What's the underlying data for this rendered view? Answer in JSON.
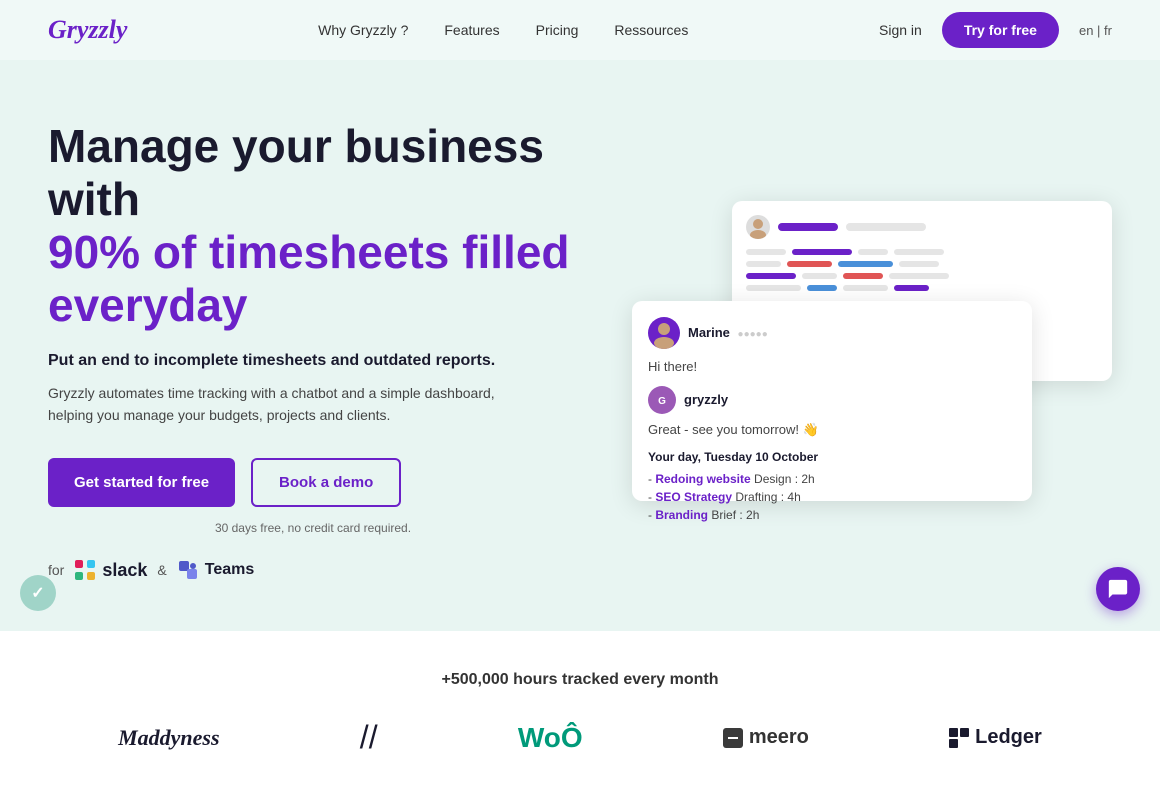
{
  "navbar": {
    "logo": "Gryzzly",
    "links": [
      {
        "label": "Why Gryzzly ?",
        "id": "why"
      },
      {
        "label": "Features",
        "id": "features"
      },
      {
        "label": "Pricing",
        "id": "pricing"
      },
      {
        "label": "Ressources",
        "id": "ressources"
      }
    ],
    "sign_in": "Sign in",
    "try_btn": "Try for free",
    "lang": "en | fr"
  },
  "hero": {
    "title_line1": "Manage your business with",
    "title_line2": "90% of timesheets filled",
    "title_line3": "everyday",
    "subtitle": "Put an end to incomplete timesheets and outdated reports.",
    "description": "Gryzzly automates time tracking with a chatbot and a simple dashboard, helping you manage your budgets, projects and clients.",
    "btn_primary": "Get started for free",
    "btn_secondary": "Book a demo",
    "note": "30 days free, no credit card required.",
    "for_label": "for",
    "and_label": "&",
    "slack_label": "slack",
    "teams_label": "Teams"
  },
  "mockup": {
    "user_name": "Marine",
    "user_greeting": "Hi there!",
    "bot_name": "gryzzly",
    "bot_message": "Great - see you tomorrow! 👋",
    "day_label": "Your day, Tuesday 10 October",
    "items": [
      {
        "prefix": "- ",
        "link": "Redoing website",
        "text": " Design : 2h"
      },
      {
        "prefix": "- ",
        "link": "SEO Strategy",
        "text": " Drafting : 4h"
      },
      {
        "prefix": "- ",
        "link": "Branding",
        "text": " Brief : 2h"
      }
    ]
  },
  "stats": {
    "tracked": "+500,000 hours tracked every month"
  },
  "logos": [
    {
      "label": "Maddyness",
      "style": "maddyness"
    },
    {
      "label": "//",
      "style": "slash"
    },
    {
      "label": "WoÔ",
      "style": "woo"
    },
    {
      "label": "meero",
      "style": "meero"
    },
    {
      "label": "Ledger",
      "style": "ledger"
    }
  ]
}
